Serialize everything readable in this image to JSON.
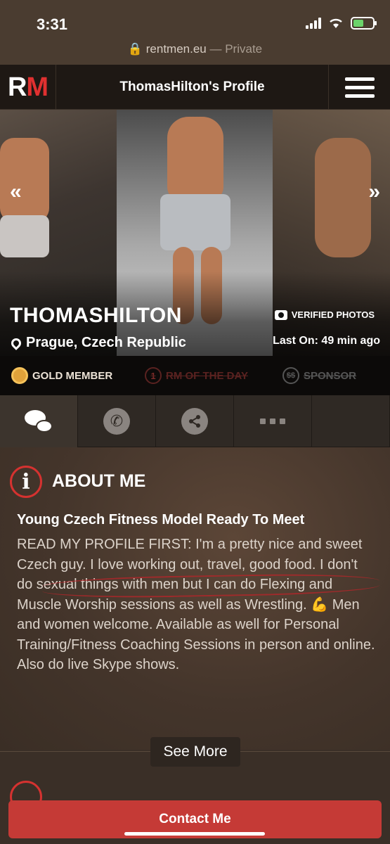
{
  "status_bar": {
    "time": "3:31"
  },
  "browser": {
    "url": "rentmen.eu",
    "privacy": "— Private",
    "lock_icon": "lock-icon"
  },
  "header": {
    "logo_r": "R",
    "logo_m": "M",
    "title": "ThomasHilton's Profile",
    "menu_icon": "hamburger-icon"
  },
  "gallery": {
    "prev_arrow": "«",
    "next_arrow": "»",
    "name": "THOMASHILTON",
    "location": "Prague, Czech Republic",
    "verified": "VERIFIED PHOTOS",
    "last_on": "Last On: 49 min ago"
  },
  "badges": {
    "gold": "GOLD MEMBER",
    "rm_day_number": "1",
    "rm_day": "RM OF THE DAY",
    "sponsor_symbol": "$$",
    "sponsor": "SPONSOR"
  },
  "actions": [
    {
      "icon": "chat-icon"
    },
    {
      "icon": "phone-icon"
    },
    {
      "icon": "share-icon"
    },
    {
      "icon": "more-icon",
      "label": "•••"
    }
  ],
  "about": {
    "title": "ABOUT ME",
    "info_glyph": "i",
    "headline": "Young Czech Fitness Model Ready To Meet",
    "bio": "READ MY PROFILE FIRST: I'm a pretty nice and sweet Czech guy. I love working out, travel, good food. I don't do sexual things with men but I can do Flexing and Muscle Worship sessions as well as Wrestling. 💪 Men and women welcome. Available as well for Personal Training/Fitness Coaching Sessions in person and online. Also do live Skype shows.",
    "see_more": "See More"
  },
  "contact": {
    "label": "Contact Me"
  },
  "colors": {
    "accent": "#c53a36",
    "gold": "#e0a23a",
    "header_bg": "#1e1814"
  }
}
